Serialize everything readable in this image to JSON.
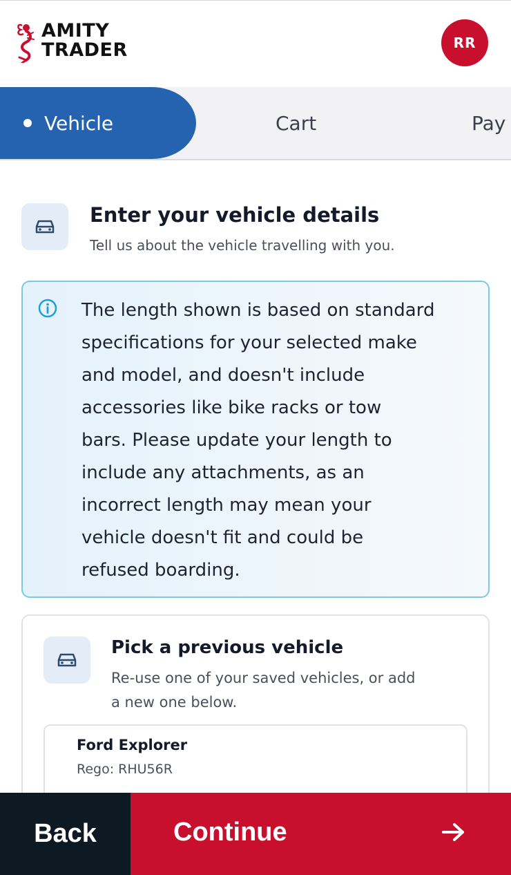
{
  "brand": {
    "line1": "AMITY",
    "line2": "TRADER",
    "accent": "#c8102e"
  },
  "user": {
    "initials": "RR"
  },
  "steps": {
    "active": "Vehicle",
    "cart": "Cart",
    "pay": "Pay"
  },
  "section": {
    "icon": "car-icon",
    "title": "Enter your vehicle details",
    "subtitle": "Tell us about the vehicle travelling with you."
  },
  "info": {
    "icon": "info-icon",
    "lines": [
      "The length shown is based on standard",
      "specifications for your selected make",
      "and model, and doesn't include",
      "accessories like bike racks or tow",
      "bars. Please update your length to",
      "include any attachments, as an",
      "incorrect length may mean your",
      "vehicle doesn't fit and could be",
      "refused boarding."
    ]
  },
  "previous": {
    "icon": "car-icon",
    "title": "Pick a previous vehicle",
    "subtitle_line1": "Re-use one of your saved vehicles, or add",
    "subtitle_line2": "a new one below.",
    "vehicles": [
      {
        "name": "Ford Explorer",
        "rego": "Rego: RHU56R"
      }
    ]
  },
  "actions": {
    "back": "Back",
    "continue": "Continue",
    "continue_icon": "arrow-right-icon"
  },
  "colors": {
    "primary_blue": "#2563b0",
    "info_border": "#7ac9e3",
    "back_bg": "#0d1a24"
  }
}
